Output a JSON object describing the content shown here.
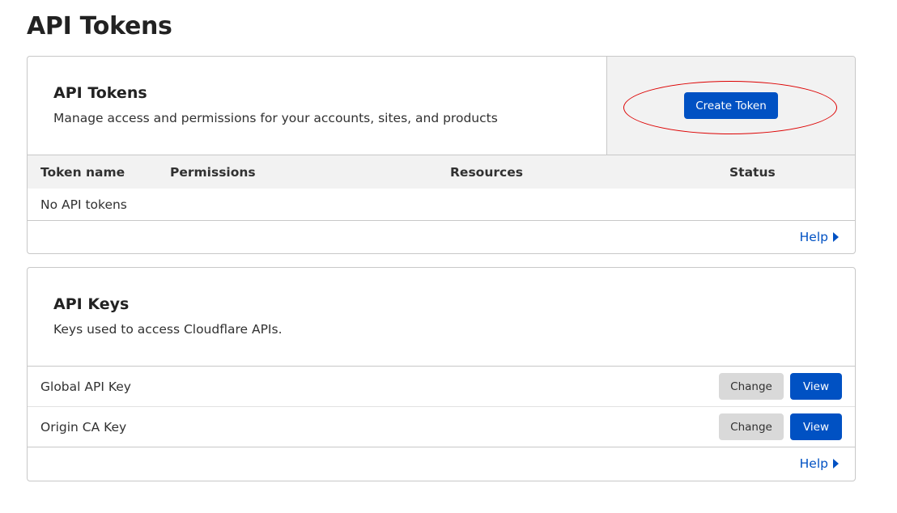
{
  "page": {
    "title": "API Tokens"
  },
  "tokens_card": {
    "title": "API Tokens",
    "description": "Manage access and permissions for your accounts, sites, and products",
    "create_button": "Create Token",
    "columns": [
      "Token name",
      "Permissions",
      "Resources",
      "Status"
    ],
    "empty_text": "No API tokens",
    "help_link": "Help"
  },
  "keys_card": {
    "title": "API Keys",
    "description": "Keys used to access Cloudflare APIs.",
    "rows": [
      {
        "name": "Global API Key",
        "change_label": "Change",
        "view_label": "View"
      },
      {
        "name": "Origin CA Key",
        "change_label": "Change",
        "view_label": "View"
      }
    ],
    "help_link": "Help"
  },
  "annotation": {
    "highlight_color": "#dd0000"
  },
  "colors": {
    "accent": "#0051c3",
    "border": "#c8c8c8",
    "muted_bg": "#f2f2f2"
  },
  "icons": {
    "help_caret": "caret-right-icon"
  }
}
